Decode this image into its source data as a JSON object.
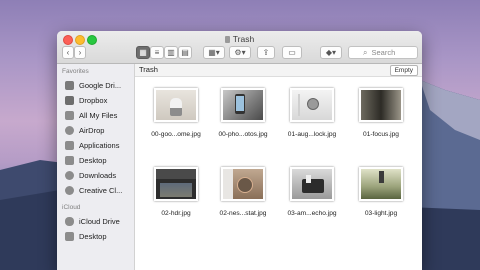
{
  "window": {
    "title": "Trash"
  },
  "toolbar": {
    "search_placeholder": "Search"
  },
  "sidebar": {
    "favorites_heading": "Favorites",
    "favorites": [
      "Google Dri...",
      "Dropbox",
      "All My Files",
      "AirDrop",
      "Applications",
      "Desktop",
      "Downloads",
      "Creative Cl..."
    ],
    "icloud_heading": "iCloud",
    "icloud": [
      "iCloud Drive",
      "Desktop"
    ]
  },
  "pathbar": {
    "label": "Trash",
    "empty_label": "Empty"
  },
  "files": [
    {
      "name": "00-goo...ome.jpg"
    },
    {
      "name": "00-pho...otos.jpg"
    },
    {
      "name": "01-aug...lock.jpg"
    },
    {
      "name": "01-focus.jpg"
    },
    {
      "name": "02-hdr.jpg"
    },
    {
      "name": "02-nes...stat.jpg"
    },
    {
      "name": "03-am...echo.jpg"
    },
    {
      "name": "03-light.jpg"
    }
  ],
  "colors": {
    "close": "#fc5f57",
    "minimize": "#fdbc2e",
    "zoom": "#28c840"
  }
}
